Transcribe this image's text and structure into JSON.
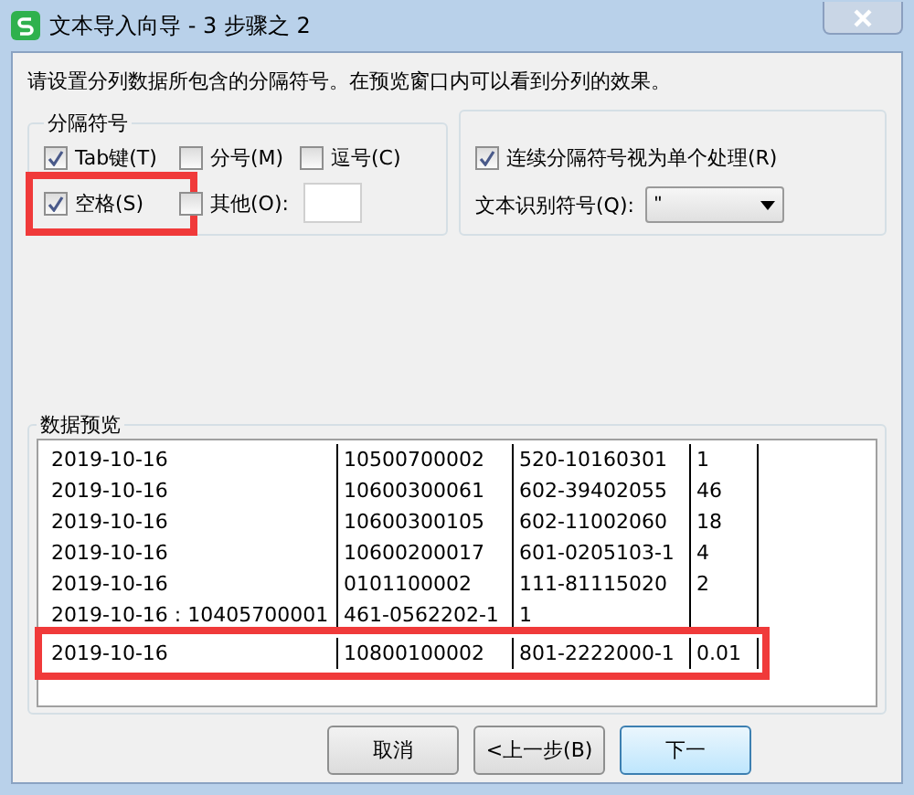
{
  "window": {
    "title": "文本导入向导 - 3 步骤之 2"
  },
  "instruction": "请设置分列数据所包含的分隔符号。在预览窗口内可以看到分列的效果。",
  "delimiters": {
    "title": "分隔符号",
    "options": [
      {
        "label": "Tab键(T)",
        "checked": true,
        "highlighted": false
      },
      {
        "label": "分号(M)",
        "checked": false,
        "highlighted": false
      },
      {
        "label": "逗号(C)",
        "checked": false,
        "highlighted": false
      },
      {
        "label": "空格(S)",
        "checked": true,
        "highlighted": true
      },
      {
        "label": "其他(O):",
        "checked": false,
        "highlighted": false,
        "has_field": true
      }
    ]
  },
  "consecutive": {
    "label": "连续分隔符号视为单个处理(R)",
    "checked": true
  },
  "qualifier": {
    "label": "文本识别符号(Q):",
    "value": "\""
  },
  "preview": {
    "title": "数据预览",
    "rows": [
      {
        "cells": [
          "2019-10-16",
          "10500700002",
          "520-10160301",
          "1"
        ],
        "highlighted": false
      },
      {
        "cells": [
          "2019-10-16",
          "10600300061",
          "602-39402055",
          "46"
        ],
        "highlighted": false
      },
      {
        "cells": [
          "2019-10-16",
          "10600300105",
          "602-11002060",
          "18"
        ],
        "highlighted": false
      },
      {
        "cells": [
          "2019-10-16",
          "10600200017",
          "601-0205103-1",
          "4"
        ],
        "highlighted": false
      },
      {
        "cells": [
          "2019-10-16",
          "0101100002",
          "111-81115020",
          "2"
        ],
        "highlighted": false
      },
      {
        "cells": [
          "2019-10-16 : 10405700001",
          "461-0562202-1",
          "1",
          ""
        ],
        "highlighted": false
      },
      {
        "cells": [
          "2019-10-16",
          "10800100002",
          "801-2222000-1",
          "0.01"
        ],
        "highlighted": true
      }
    ]
  },
  "buttons": [
    "取消",
    "<上一步(B)",
    "下一"
  ]
}
